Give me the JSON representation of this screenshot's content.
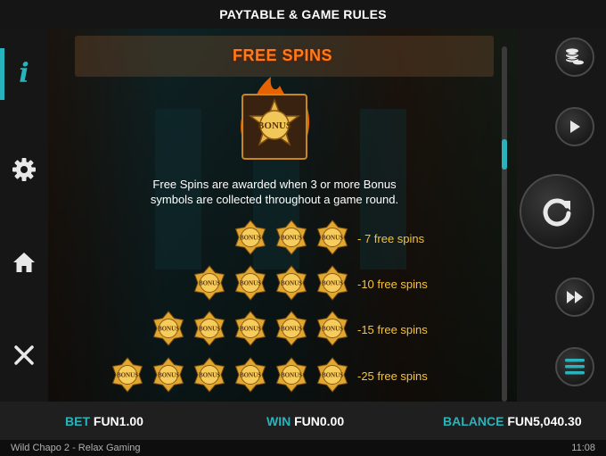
{
  "window": {
    "title": "PAYTABLE & GAME RULES"
  },
  "sidebar": {
    "items": [
      {
        "name": "info",
        "icon": "info-icon",
        "active": true
      },
      {
        "name": "settings",
        "icon": "gear-icon",
        "active": false
      },
      {
        "name": "home",
        "icon": "home-icon",
        "active": false
      },
      {
        "name": "close",
        "icon": "close-icon",
        "active": false
      }
    ]
  },
  "section": {
    "title": "FREE SPINS",
    "hero_badge_text": "BONUS",
    "description_line1": "Free Spins are awarded when 3 or more Bonus",
    "description_line2": "symbols are collected throughout a game round."
  },
  "paytable": [
    {
      "count": 3,
      "label": "- 7 free spins"
    },
    {
      "count": 4,
      "label": "-10 free spins"
    },
    {
      "count": 5,
      "label": "-15 free spins"
    },
    {
      "count": 6,
      "label": "-25 free spins"
    }
  ],
  "badge_text": "BONUS",
  "controls": {
    "right": [
      "coins-stack-icon",
      "play-icon",
      "spin-icon",
      "fast-forward-icon",
      "menu-icon"
    ]
  },
  "footer": {
    "bet_label": "BET",
    "bet_value": "FUN1.00",
    "win_label": "WIN",
    "win_value": "FUN0.00",
    "balance_label": "BALANCE",
    "balance_value": "FUN5,040.30"
  },
  "status": {
    "app_name": "Wild Chapo 2 - Relax Gaming",
    "time": "11:08"
  },
  "colors": {
    "accent": "#27b5bd",
    "title_orange": "#ff7a1a",
    "payout_gold": "#f6c338"
  }
}
